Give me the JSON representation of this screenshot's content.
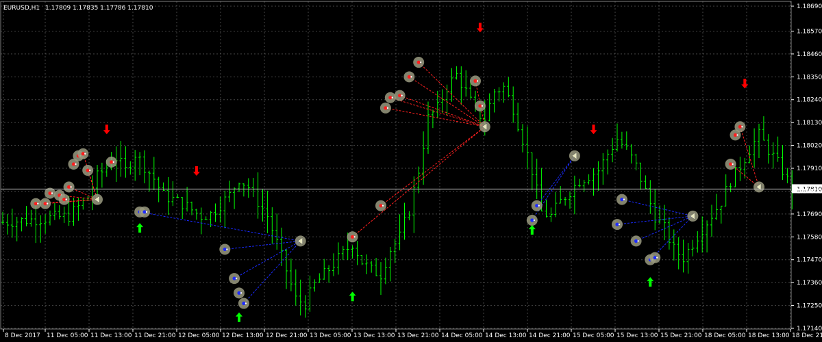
{
  "window": {
    "symbol_label": "EURUSD,H1",
    "ohlc_label": "1.17809 1.17835 1.17786 1.17810"
  },
  "colors": {
    "background": "#000000",
    "grid": "#808080",
    "candle": "#00ff00",
    "axis_text": "#ffffff",
    "current_price_line": "#c0c0c0",
    "buy_arrow": "#00ff00",
    "sell_arrow": "#ff0000",
    "buy_link": "#1a2aff",
    "sell_link": "#ff2020",
    "marker_fill": "#9a9a80"
  },
  "icons": {
    "buy_signal": "arrow-up-icon",
    "sell_signal": "arrow-down-icon",
    "buy_order_marker": "blue-dot-icon",
    "sell_order_marker": "red-dot-icon",
    "close_marker": "triangle-left-icon"
  },
  "chart_data": {
    "type": "candlestick",
    "symbol": "EURUSD",
    "timeframe": "H1",
    "ylim": [
      1.1714,
      1.1869
    ],
    "y_ticks": [
      "1.18690",
      "1.18570",
      "1.18460",
      "1.18350",
      "1.18240",
      "1.18130",
      "1.18020",
      "1.17910",
      "1.17800",
      "1.17690",
      "1.17580",
      "1.17470",
      "1.17360",
      "1.17250",
      "1.17140"
    ],
    "current_price": "1.17810",
    "x_ticks": [
      "8 Dec 2017",
      "11 Dec 05:00",
      "11 Dec 13:00",
      "11 Dec 21:00",
      "12 Dec 05:00",
      "12 Dec 13:00",
      "12 Dec 21:00",
      "13 Dec 05:00",
      "13 Dec 13:00",
      "13 Dec 21:00",
      "14 Dec 05:00",
      "14 Dec 13:00",
      "14 Dec 21:00",
      "15 Dec 05:00",
      "15 Dec 13:00",
      "15 Dec 21:00",
      "18 Dec 05:00",
      "18 Dec 13:00",
      "18 Dec 21:00"
    ],
    "close_path": [
      [
        0,
        1.1765
      ],
      [
        14,
        1.1768
      ],
      [
        18,
        1.1777
      ],
      [
        20,
        1.1787
      ],
      [
        24,
        1.1796
      ],
      [
        26,
        1.179
      ],
      [
        28,
        1.1798
      ],
      [
        32,
        1.1786
      ],
      [
        34,
        1.1778
      ],
      [
        38,
        1.1774
      ],
      [
        42,
        1.1768
      ],
      [
        44,
        1.1769
      ],
      [
        48,
        1.1778
      ],
      [
        50,
        1.1786
      ],
      [
        52,
        1.1782
      ],
      [
        54,
        1.1775
      ],
      [
        56,
        1.1768
      ],
      [
        58,
        1.1755
      ],
      [
        60,
        1.1742
      ],
      [
        62,
        1.1728
      ],
      [
        64,
        1.1726
      ],
      [
        66,
        1.1735
      ],
      [
        70,
        1.1745
      ],
      [
        74,
        1.1755
      ],
      [
        76,
        1.1746
      ],
      [
        78,
        1.1742
      ],
      [
        80,
        1.174
      ],
      [
        82,
        1.1752
      ],
      [
        84,
        1.1758
      ],
      [
        86,
        1.1771
      ],
      [
        88,
        1.179
      ],
      [
        90,
        1.1815
      ],
      [
        92,
        1.182
      ],
      [
        94,
        1.183
      ],
      [
        96,
        1.1836
      ],
      [
        98,
        1.1828
      ],
      [
        100,
        1.1818
      ],
      [
        102,
        1.1815
      ],
      [
        104,
        1.1828
      ],
      [
        106,
        1.183
      ],
      [
        108,
        1.182
      ],
      [
        110,
        1.1805
      ],
      [
        112,
        1.179
      ],
      [
        114,
        1.177
      ],
      [
        116,
        1.1768
      ],
      [
        118,
        1.1775
      ],
      [
        120,
        1.178
      ],
      [
        122,
        1.1785
      ],
      [
        126,
        1.179
      ],
      [
        128,
        1.1798
      ],
      [
        130,
        1.1805
      ],
      [
        132,
        1.18
      ],
      [
        134,
        1.1792
      ],
      [
        136,
        1.178
      ],
      [
        138,
        1.1768
      ],
      [
        140,
        1.1762
      ],
      [
        142,
        1.1752
      ],
      [
        144,
        1.1748
      ],
      [
        146,
        1.1755
      ],
      [
        148,
        1.1762
      ],
      [
        152,
        1.1775
      ],
      [
        154,
        1.1785
      ],
      [
        156,
        1.1792
      ],
      [
        158,
        1.18
      ],
      [
        160,
        1.1807
      ],
      [
        162,
        1.18
      ],
      [
        165,
        1.179
      ],
      [
        167,
        1.1781
      ]
    ],
    "signals": [
      {
        "type": "buy",
        "bar": 29,
        "value": 1.1762
      },
      {
        "type": "sell",
        "bar": 22,
        "value": 1.181
      },
      {
        "type": "sell",
        "bar": 41,
        "value": 1.179
      },
      {
        "type": "buy",
        "bar": 50,
        "value": 1.1719
      },
      {
        "type": "buy",
        "bar": 74,
        "value": 1.1729
      },
      {
        "type": "sell",
        "bar": 101,
        "value": 1.1859
      },
      {
        "type": "buy",
        "bar": 112,
        "value": 1.1761
      },
      {
        "type": "sell",
        "bar": 125,
        "value": 1.181
      },
      {
        "type": "buy",
        "bar": 137,
        "value": 1.1736
      },
      {
        "type": "sell",
        "bar": 157,
        "value": 1.1832
      }
    ],
    "markers": [
      {
        "kind": "sell",
        "bar": 7,
        "value": 1.1774
      },
      {
        "kind": "sell",
        "bar": 9,
        "value": 1.1774
      },
      {
        "kind": "sell",
        "bar": 10,
        "value": 1.1779
      },
      {
        "kind": "sell",
        "bar": 12,
        "value": 1.1778
      },
      {
        "kind": "sell",
        "bar": 13,
        "value": 1.1776
      },
      {
        "kind": "sell",
        "bar": 14,
        "value": 1.1782
      },
      {
        "kind": "sell",
        "bar": 15,
        "value": 1.1793
      },
      {
        "kind": "sell",
        "bar": 16,
        "value": 1.1797
      },
      {
        "kind": "sell",
        "bar": 17,
        "value": 1.1798
      },
      {
        "kind": "sell",
        "bar": 18,
        "value": 1.179
      },
      {
        "kind": "sell",
        "bar": 23,
        "value": 1.1794
      },
      {
        "kind": "close",
        "bar": 20,
        "value": 1.1776
      },
      {
        "kind": "buy",
        "bar": 29,
        "value": 1.177
      },
      {
        "kind": "buy",
        "bar": 30,
        "value": 1.177
      },
      {
        "kind": "buy",
        "bar": 47,
        "value": 1.1752
      },
      {
        "kind": "buy",
        "bar": 49,
        "value": 1.1738
      },
      {
        "kind": "buy",
        "bar": 50,
        "value": 1.1731
      },
      {
        "kind": "buy",
        "bar": 51,
        "value": 1.1726
      },
      {
        "kind": "close",
        "bar": 63,
        "value": 1.1756
      },
      {
        "kind": "sell",
        "bar": 80,
        "value": 1.1773
      },
      {
        "kind": "sell",
        "bar": 74,
        "value": 1.1758
      },
      {
        "kind": "sell",
        "bar": 81,
        "value": 1.182
      },
      {
        "kind": "sell",
        "bar": 82,
        "value": 1.1825
      },
      {
        "kind": "sell",
        "bar": 84,
        "value": 1.1826
      },
      {
        "kind": "sell",
        "bar": 86,
        "value": 1.1835
      },
      {
        "kind": "sell",
        "bar": 88,
        "value": 1.1842
      },
      {
        "kind": "sell",
        "bar": 100,
        "value": 1.1833
      },
      {
        "kind": "sell",
        "bar": 101,
        "value": 1.1821
      },
      {
        "kind": "close",
        "bar": 102,
        "value": 1.1811
      },
      {
        "kind": "buy",
        "bar": 112,
        "value": 1.1766
      },
      {
        "kind": "buy",
        "bar": 113,
        "value": 1.1773
      },
      {
        "kind": "close",
        "bar": 121,
        "value": 1.1797
      },
      {
        "kind": "buy",
        "bar": 131,
        "value": 1.1776
      },
      {
        "kind": "buy",
        "bar": 130,
        "value": 1.1764
      },
      {
        "kind": "buy",
        "bar": 134,
        "value": 1.1756
      },
      {
        "kind": "buy",
        "bar": 137,
        "value": 1.1747
      },
      {
        "kind": "buy",
        "bar": 138,
        "value": 1.1748
      },
      {
        "kind": "close",
        "bar": 146,
        "value": 1.1768
      },
      {
        "kind": "sell",
        "bar": 154,
        "value": 1.1793
      },
      {
        "kind": "sell",
        "bar": 155,
        "value": 1.1807
      },
      {
        "kind": "sell",
        "bar": 156,
        "value": 1.1811
      },
      {
        "kind": "close",
        "bar": 160,
        "value": 1.1782
      }
    ],
    "links": [
      {
        "kind": "sell",
        "from": [
          7,
          1.1774
        ],
        "to": [
          20,
          1.1776
        ]
      },
      {
        "kind": "sell",
        "from": [
          9,
          1.1774
        ],
        "to": [
          20,
          1.1776
        ]
      },
      {
        "kind": "sell",
        "from": [
          12,
          1.1778
        ],
        "to": [
          20,
          1.1776
        ]
      },
      {
        "kind": "sell",
        "from": [
          14,
          1.1782
        ],
        "to": [
          20,
          1.1776
        ]
      },
      {
        "kind": "sell",
        "from": [
          17,
          1.1798
        ],
        "to": [
          20,
          1.1776
        ]
      },
      {
        "kind": "sell",
        "from": [
          18,
          1.179
        ],
        "to": [
          20,
          1.1776
        ]
      },
      {
        "kind": "buy",
        "from": [
          29,
          1.177
        ],
        "to": [
          63,
          1.1756
        ]
      },
      {
        "kind": "buy",
        "from": [
          47,
          1.1752
        ],
        "to": [
          63,
          1.1756
        ]
      },
      {
        "kind": "buy",
        "from": [
          49,
          1.1738
        ],
        "to": [
          63,
          1.1756
        ]
      },
      {
        "kind": "buy",
        "from": [
          51,
          1.1726
        ],
        "to": [
          63,
          1.1756
        ]
      },
      {
        "kind": "sell",
        "from": [
          80,
          1.1773
        ],
        "to": [
          102,
          1.1811
        ]
      },
      {
        "kind": "sell",
        "from": [
          74,
          1.1758
        ],
        "to": [
          102,
          1.1811
        ]
      },
      {
        "kind": "sell",
        "from": [
          81,
          1.182
        ],
        "to": [
          102,
          1.1811
        ]
      },
      {
        "kind": "sell",
        "from": [
          82,
          1.1825
        ],
        "to": [
          102,
          1.1811
        ]
      },
      {
        "kind": "sell",
        "from": [
          84,
          1.1826
        ],
        "to": [
          102,
          1.1811
        ]
      },
      {
        "kind": "sell",
        "from": [
          86,
          1.1835
        ],
        "to": [
          102,
          1.1811
        ]
      },
      {
        "kind": "sell",
        "from": [
          88,
          1.1842
        ],
        "to": [
          102,
          1.1811
        ]
      },
      {
        "kind": "sell",
        "from": [
          100,
          1.1833
        ],
        "to": [
          102,
          1.1811
        ]
      },
      {
        "kind": "buy",
        "from": [
          112,
          1.1766
        ],
        "to": [
          121,
          1.1797
        ]
      },
      {
        "kind": "buy",
        "from": [
          113,
          1.1773
        ],
        "to": [
          121,
          1.1797
        ]
      },
      {
        "kind": "buy",
        "from": [
          131,
          1.1776
        ],
        "to": [
          146,
          1.1768
        ]
      },
      {
        "kind": "buy",
        "from": [
          130,
          1.1764
        ],
        "to": [
          146,
          1.1768
        ]
      },
      {
        "kind": "buy",
        "from": [
          134,
          1.1756
        ],
        "to": [
          146,
          1.1768
        ]
      },
      {
        "kind": "buy",
        "from": [
          137,
          1.1747
        ],
        "to": [
          146,
          1.1768
        ]
      },
      {
        "kind": "sell",
        "from": [
          154,
          1.1793
        ],
        "to": [
          160,
          1.1782
        ]
      },
      {
        "kind": "sell",
        "from": [
          156,
          1.1811
        ],
        "to": [
          160,
          1.1782
        ]
      }
    ],
    "grid": true,
    "legend": "none"
  }
}
